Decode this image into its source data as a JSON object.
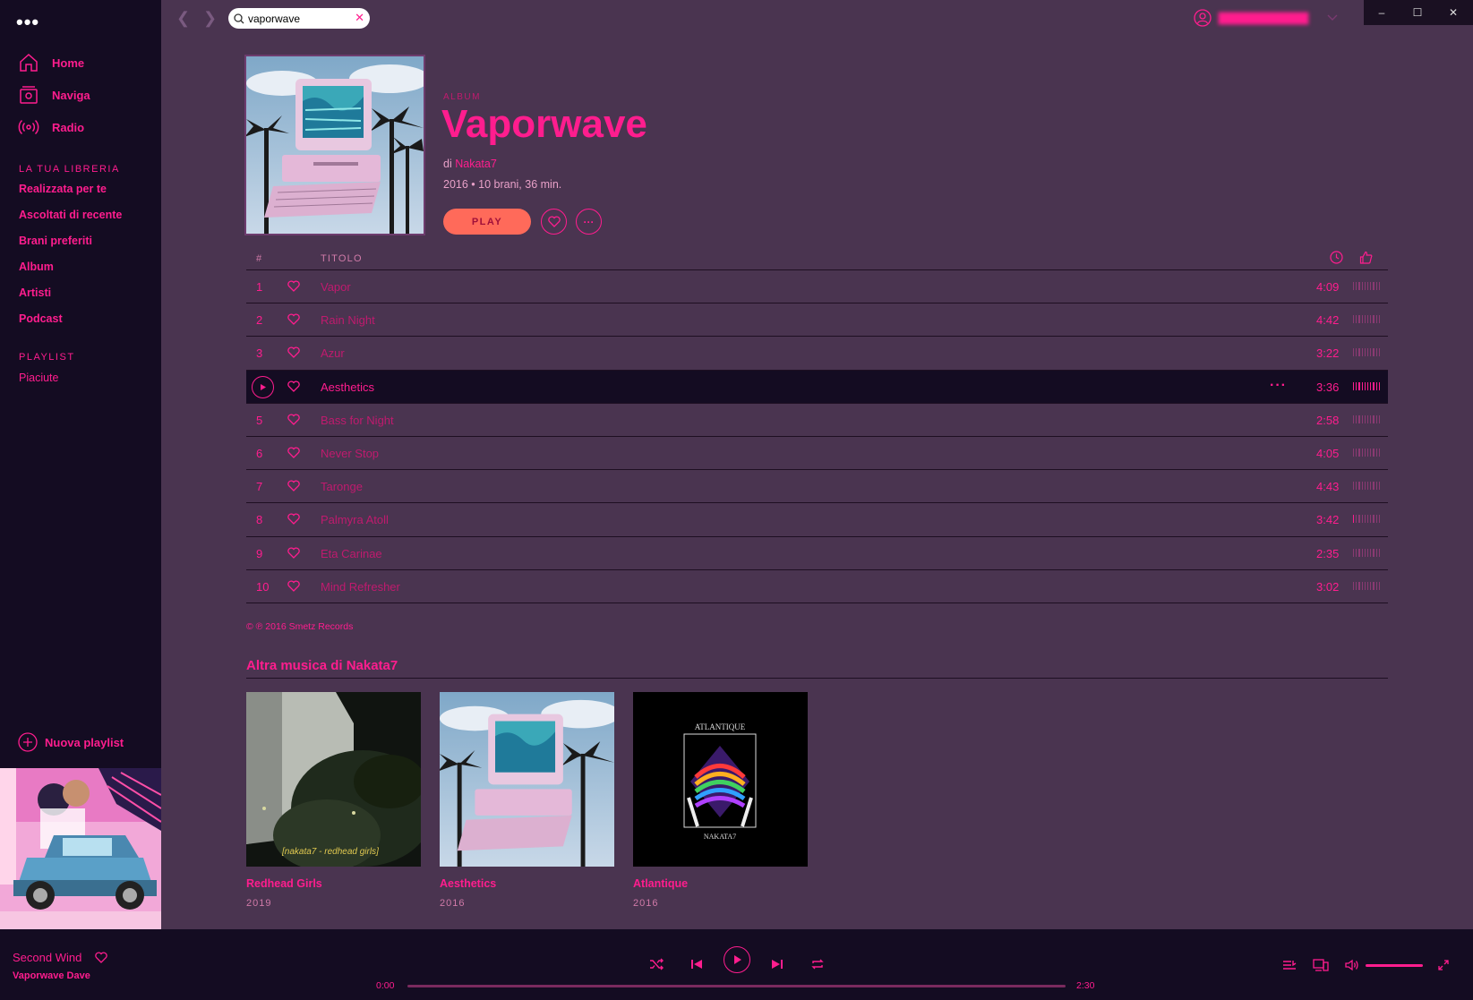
{
  "sidebar": {
    "menu_dots": "•••",
    "nav": [
      {
        "label": "Home",
        "icon": "home-icon"
      },
      {
        "label": "Naviga",
        "icon": "browse-icon"
      },
      {
        "label": "Radio",
        "icon": "radio-icon"
      }
    ],
    "library_title": "LA TUA LIBRERIA",
    "library": [
      "Realizzata per te",
      "Ascoltati di recente",
      "Brani preferiti",
      "Album",
      "Artisti",
      "Podcast"
    ],
    "playlist_title": "PLAYLIST",
    "playlists": [
      "Piaciute"
    ],
    "new_playlist": "Nuova playlist"
  },
  "topbar": {
    "search_value": "vaporwave",
    "clear_icon": "✕",
    "window_controls": [
      "–",
      "☐",
      "✕"
    ]
  },
  "album": {
    "type": "ALBUM",
    "title": "Vaporwave",
    "by_prefix": "di",
    "artist": "Nakata7",
    "meta": "2016 • 10 brani, 36 min.",
    "play_label": "PLAY",
    "more_label": "···"
  },
  "tracklist": {
    "header_num": "#",
    "header_title": "TITOLO",
    "tracks": [
      {
        "n": "1",
        "title": "Vapor",
        "duration": "4:09",
        "popularity": 0
      },
      {
        "n": "2",
        "title": "Rain Night",
        "duration": "4:42",
        "popularity": 0
      },
      {
        "n": "3",
        "title": "Azur",
        "duration": "3:22",
        "popularity": 0
      },
      {
        "n": "4",
        "title": "Aesthetics",
        "duration": "3:36",
        "popularity": 10,
        "active": true
      },
      {
        "n": "5",
        "title": "Bass for Night",
        "duration": "2:58",
        "popularity": 0
      },
      {
        "n": "6",
        "title": "Never Stop",
        "duration": "4:05",
        "popularity": 0
      },
      {
        "n": "7",
        "title": "Taronge",
        "duration": "4:43",
        "popularity": 0
      },
      {
        "n": "8",
        "title": "Palmyra Atoll",
        "duration": "3:42",
        "popularity": 1
      },
      {
        "n": "9",
        "title": "Eta Carinae",
        "duration": "2:35",
        "popularity": 0
      },
      {
        "n": "10",
        "title": "Mind Refresher",
        "duration": "3:02",
        "popularity": 0
      }
    ],
    "active_more": "···"
  },
  "copyright": "© ℗ 2016 Smetz Records",
  "more_music": {
    "title": "Altra musica di Nakata7",
    "albums": [
      {
        "name": "Redhead Girls",
        "year": "2019",
        "caption": "[nakata7 - redhead girls]"
      },
      {
        "name": "Aesthetics",
        "year": "2016"
      },
      {
        "name": "Atlantique",
        "year": "2016",
        "cover_top": "ATLANTIQUE",
        "cover_bottom": "NAKATA7"
      }
    ]
  },
  "player": {
    "title": "Second Wind",
    "artist": "Vaporwave Dave",
    "time_elapsed": "0:00",
    "time_total": "2:30",
    "progress": 0,
    "volume": 1.0
  },
  "colors": {
    "accent": "#ff1d8e",
    "background": "#4a3450",
    "sidebar": "#140c22",
    "play_button": "#ff6a5a"
  }
}
